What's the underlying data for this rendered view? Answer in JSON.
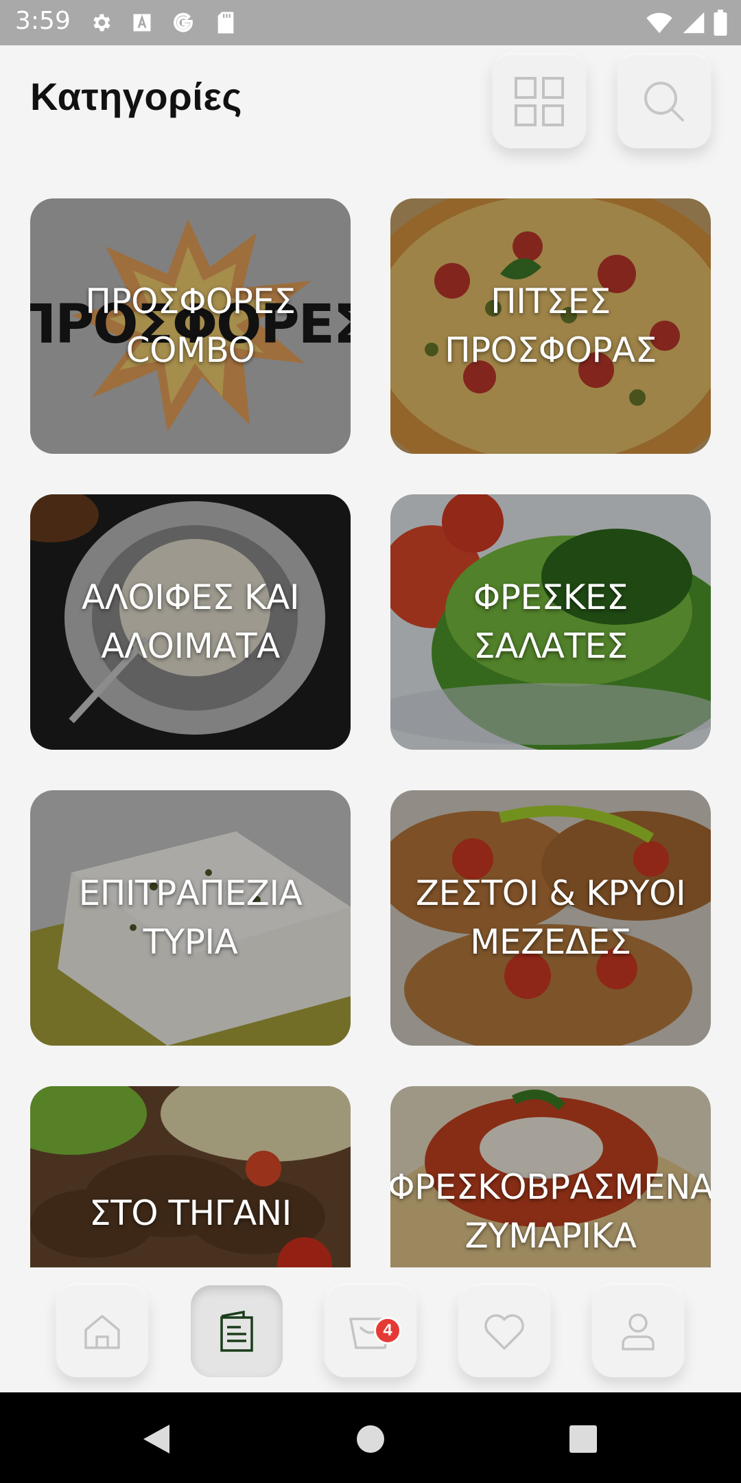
{
  "status_bar": {
    "time": "3:59",
    "icons": [
      "gear-icon",
      "font-icon",
      "google-icon",
      "sd-card-icon",
      "wifi-icon",
      "signal-icon",
      "battery-icon"
    ]
  },
  "header": {
    "title": "Κατηγορίες",
    "view_toggle_icon": "grid-view-icon",
    "search_icon": "search-icon"
  },
  "categories": [
    {
      "label": "ΠΡΟΣΦΟΡΕΣ\nCOMBO",
      "image": "offers-burst-image"
    },
    {
      "label": "ΠΙΤΣΕΣ\nΠΡΟΣΦΟΡΑΣ",
      "image": "pizza-image"
    },
    {
      "label": "ΑΛΟΙΦΕΣ ΚΑΙ\nΑΛΟΙΜΑΤΑ",
      "image": "spread-dish-image"
    },
    {
      "label": "ΦΡΕΣΚΕΣ ΣΑΛΑΤΕΣ",
      "image": "salad-image"
    },
    {
      "label": "ΕΠΙΤΡΑΠΕΖΙΑ\nΤΥΡΙΑ",
      "image": "feta-cheese-image"
    },
    {
      "label": "ΖΕΣΤΟΙ & ΚΡΥΟΙ\nΜΕΖΕΔΕΣ",
      "image": "bruschetta-image"
    },
    {
      "label": "ΣΤΟ ΤΗΓΑΝΙ",
      "image": "fried-meat-image"
    },
    {
      "label": "ΦΡΕΣΚΟΒΡΑΣΜΕΝΑ\nΖΥΜΑΡΙΚΑ",
      "image": "pasta-image"
    }
  ],
  "bottom_nav": {
    "items": [
      "home-icon",
      "menu-icon",
      "cart-icon",
      "heart-icon",
      "profile-icon"
    ],
    "active": "menu-icon",
    "cart_badge": "4"
  },
  "colors": {
    "badge": "#e53935",
    "active_icon": "#1b3d1b",
    "inactive_icon": "#bdbdbd"
  }
}
